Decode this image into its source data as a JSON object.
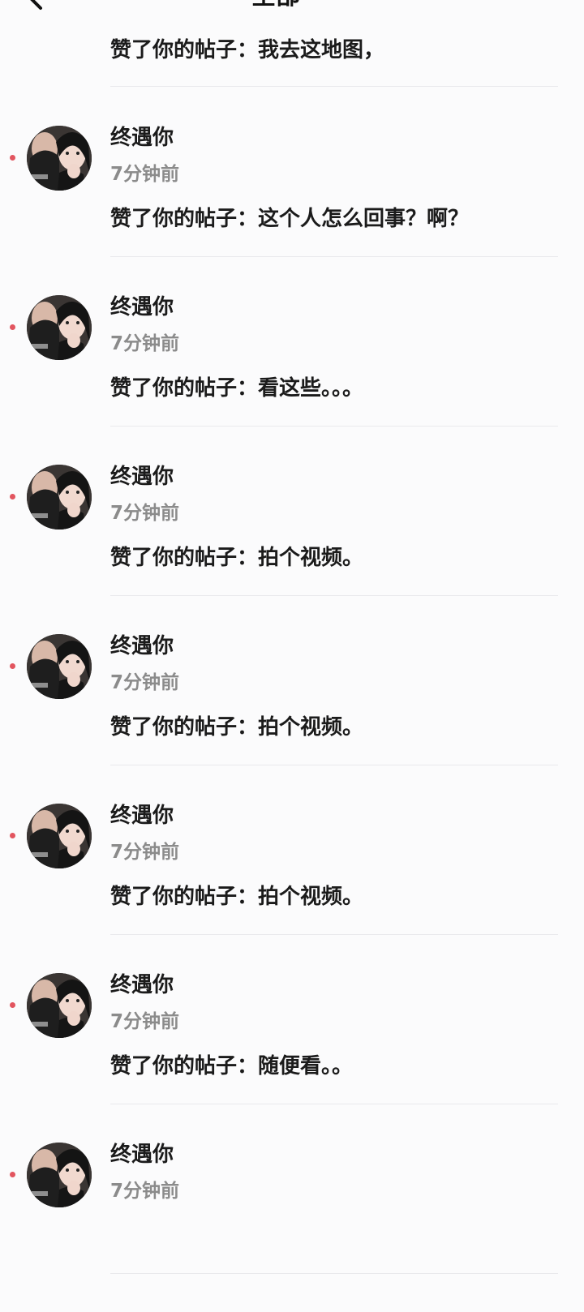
{
  "header": {
    "title": "全部"
  },
  "first_item": {
    "message": "赞了你的帖子：我去这地图，"
  },
  "notifications": [
    {
      "user": "终遇你",
      "time": "7分钟前",
      "message": "赞了你的帖子：这个人怎么回事？啊？",
      "unread": true
    },
    {
      "user": "终遇你",
      "time": "7分钟前",
      "message": "赞了你的帖子：看这些。。。",
      "unread": true
    },
    {
      "user": "终遇你",
      "time": "7分钟前",
      "message": "赞了你的帖子：拍个视频。",
      "unread": true
    },
    {
      "user": "终遇你",
      "time": "7分钟前",
      "message": "赞了你的帖子：拍个视频。",
      "unread": true
    },
    {
      "user": "终遇你",
      "time": "7分钟前",
      "message": "赞了你的帖子：拍个视频。",
      "unread": true
    },
    {
      "user": "终遇你",
      "time": "7分钟前",
      "message": "赞了你的帖子：随便看。。",
      "unread": true
    },
    {
      "user": "终遇你",
      "time": "7分钟前",
      "message": "",
      "unread": true
    }
  ],
  "colors": {
    "unread_dot": "#e2555f",
    "time_text": "#8b8b8b",
    "divider": "#e9e9ec"
  },
  "icons": {
    "back": "back-arrow-icon",
    "dropdown": "chevron-down-icon"
  }
}
